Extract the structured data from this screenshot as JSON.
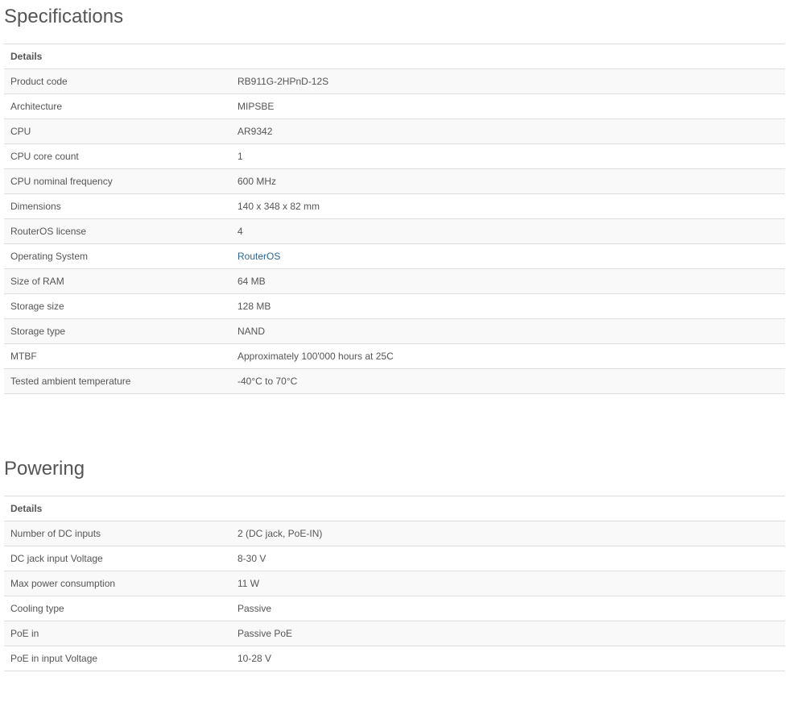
{
  "specifications": {
    "title": "Specifications",
    "header": "Details",
    "rows": [
      {
        "label": "Product code",
        "value": "RB911G-2HPnD-12S"
      },
      {
        "label": "Architecture",
        "value": "MIPSBE"
      },
      {
        "label": "CPU",
        "value": "AR9342"
      },
      {
        "label": "CPU core count",
        "value": "1"
      },
      {
        "label": "CPU nominal frequency",
        "value": "600 MHz"
      },
      {
        "label": "Dimensions",
        "value": "140 x 348 x 82 mm"
      },
      {
        "label": "RouterOS license",
        "value": "4"
      },
      {
        "label": "Operating System",
        "value": "RouterOS"
      },
      {
        "label": "Size of RAM",
        "value": "64 MB"
      },
      {
        "label": "Storage size",
        "value": "128 MB"
      },
      {
        "label": "Storage type",
        "value": "NAND"
      },
      {
        "label": "MTBF",
        "value": "Approximately 100'000 hours at 25C"
      },
      {
        "label": "Tested ambient temperature",
        "value": "-40°C to 70°C"
      }
    ]
  },
  "powering": {
    "title": "Powering",
    "header": "Details",
    "rows": [
      {
        "label": "Number of DC inputs",
        "value": "2 (DC jack, PoE-IN)"
      },
      {
        "label": "DC jack input Voltage",
        "value": "8-30 V"
      },
      {
        "label": "Max power consumption",
        "value": "11 W"
      },
      {
        "label": "Cooling type",
        "value": "Passive"
      },
      {
        "label": "PoE in",
        "value": "Passive PoE"
      },
      {
        "label": "PoE in input Voltage",
        "value": "10-28 V"
      }
    ]
  },
  "colors": {
    "text": "#555555",
    "link": "#2a6496",
    "stripe": "#f9f9f9",
    "border": "#dddddd"
  }
}
